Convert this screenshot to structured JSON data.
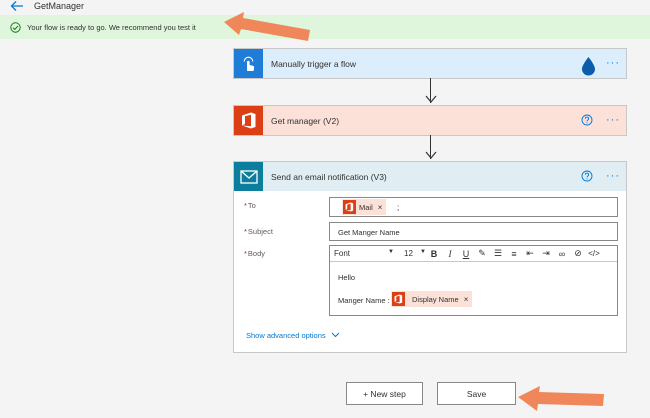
{
  "header": {
    "title": "GetManager",
    "back_icon": "back-arrow-icon"
  },
  "banner": {
    "message": "Your flow is ready to go. We recommend you test it",
    "icon": "check-circle-icon",
    "color": "#dff6dd"
  },
  "steps": [
    {
      "title": "Manually trigger a flow",
      "icon": "touch-icon",
      "color": "#1f7dd8",
      "more": "···"
    },
    {
      "title": "Get manager (V2)",
      "icon": "office-icon",
      "color": "#dc3e15",
      "more": "···"
    },
    {
      "title": "Send an email notification (V3)",
      "icon": "mail-icon",
      "color": "#0b7e9e",
      "more": "···"
    }
  ],
  "email": {
    "to": {
      "label": "To",
      "token": "Mail",
      "suffix": ";"
    },
    "subject": {
      "label": "Subject",
      "value": "Get Manger Name"
    },
    "body": {
      "label": "Body",
      "font": "Font",
      "font_size": "12",
      "line1": "Hello",
      "line2_prefix": "Manger Name :",
      "token": "Display Name"
    },
    "advanced": "Show advanced options"
  },
  "buttons": {
    "new_step": "+ New step",
    "save": "Save"
  },
  "annotation_color": "#f0875a"
}
